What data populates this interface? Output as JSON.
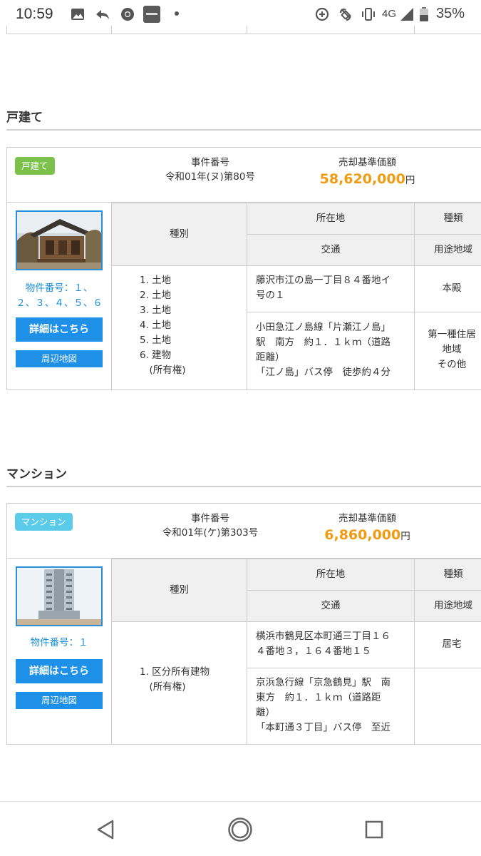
{
  "status_bar": {
    "time": "10:59",
    "network": "4G",
    "battery": "35%",
    "icons": [
      "image-icon",
      "reply-icon",
      "chrome-icon",
      "app-icon",
      "data-saver-icon",
      "nfc-icon",
      "vibrate-icon",
      "signal-icon",
      "battery-icon"
    ]
  },
  "sections": [
    {
      "title": "戸建て",
      "badge": "戸建て",
      "badge_color": "#7cc24a",
      "case_label": "事件番号",
      "case_number": "令和01年(ヌ)第80号",
      "price_label": "売却基準価額",
      "price": "58,620,000",
      "price_unit": "円",
      "thumb_icon": "house-photo-icon",
      "item_no": [
        "物件番号：１、",
        "２、３、４、５、６"
      ],
      "detail_button": "詳細はこちら",
      "map_button": "周辺地図",
      "headers": {
        "kind": "種別",
        "location": "所在地",
        "type": "種類",
        "transport": "交通",
        "zoning": "用途地域"
      },
      "kind_items": [
        "1. 土地",
        "2. 土地",
        "3. 土地",
        "4. 土地",
        "5. 土地",
        "6. 建物",
        "　(所有権)"
      ],
      "location": [
        "藤沢市江の島一丁目８４番地イ",
        "号の１"
      ],
      "type_value": "本殿",
      "transport": [
        "小田急江ノ島線「片瀬江ノ島」",
        "駅　南方　約１．１ｋｍ（道路",
        "距離）",
        "「江ノ島」バス停　徒歩約４分"
      ],
      "zoning": [
        "第一種住居",
        "地域",
        "その他"
      ]
    },
    {
      "title": "マンション",
      "badge": "マンション",
      "badge_color": "#5ccbea",
      "case_label": "事件番号",
      "case_number": "令和01年(ケ)第303号",
      "price_label": "売却基準価額",
      "price": "6,860,000",
      "price_unit": "円",
      "thumb_icon": "building-photo-icon",
      "item_no": [
        "物件番号：１"
      ],
      "detail_button": "詳細はこちら",
      "map_button": "周辺地図",
      "headers": {
        "kind": "種別",
        "location": "所在地",
        "type": "種類",
        "transport": "交通",
        "zoning": "用途地域"
      },
      "kind_items": [
        "1. 区分所有建物",
        "　(所有権)"
      ],
      "location": [
        "横浜市鶴見区本町通三丁目１６",
        "４番地３，１６４番地１５"
      ],
      "type_value": "居宅",
      "transport": [
        "京浜急行線「京急鶴見」駅　南",
        "東方　約１．１ｋｍ（道路距",
        "離）",
        "「本町通３丁目」バス停　至近"
      ],
      "zoning": []
    }
  ]
}
